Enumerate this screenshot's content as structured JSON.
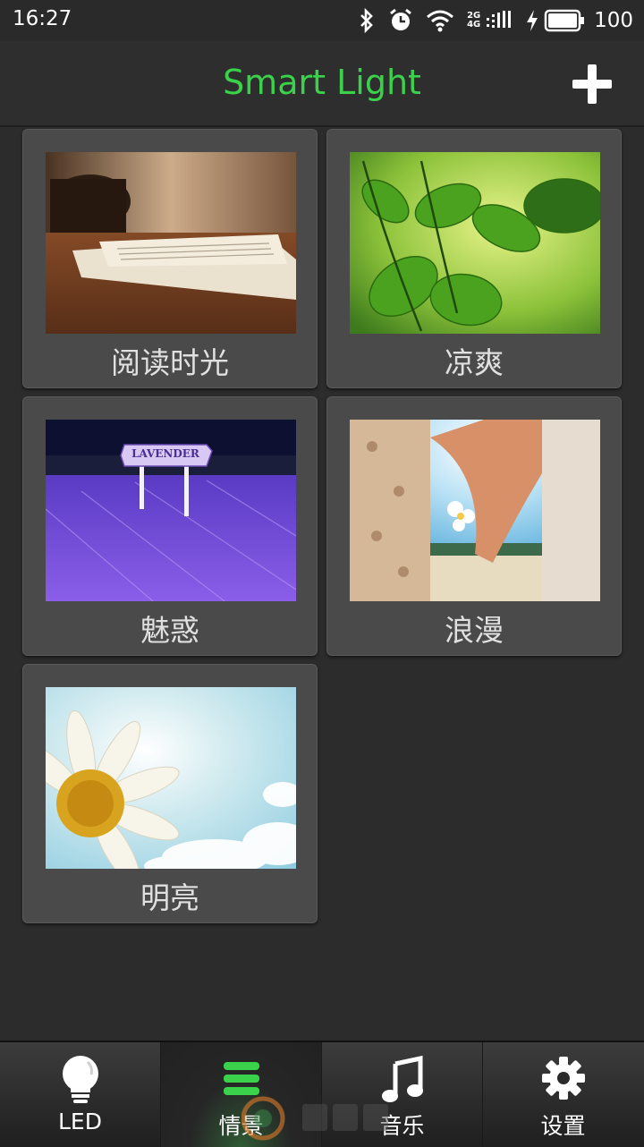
{
  "status_bar": {
    "time": "16:27",
    "network": "2G 4G",
    "battery": "100"
  },
  "header": {
    "title": "Smart Light",
    "add_icon": "plus-icon"
  },
  "scenes": [
    {
      "label": "阅读时光",
      "image": "reading-newspaper-photo"
    },
    {
      "label": "凉爽",
      "image": "green-leaves-photo"
    },
    {
      "label": "魅惑",
      "image": "lavender-field-photo",
      "sign_text": "LAVENDER"
    },
    {
      "label": "浪漫",
      "image": "holding-hands-photo"
    },
    {
      "label": "明亮",
      "image": "daisy-sky-photo"
    }
  ],
  "bottom_nav": {
    "items": [
      {
        "label": "LED",
        "icon": "lightbulb-icon"
      },
      {
        "label": "情景",
        "icon": "menu-icon",
        "active": true
      },
      {
        "label": "音乐",
        "icon": "music-note-icon"
      },
      {
        "label": "设置",
        "icon": "gear-icon"
      }
    ]
  },
  "colors": {
    "accent": "#3ad24a",
    "background": "#2c2c2c",
    "card": "#4a4a4a"
  }
}
